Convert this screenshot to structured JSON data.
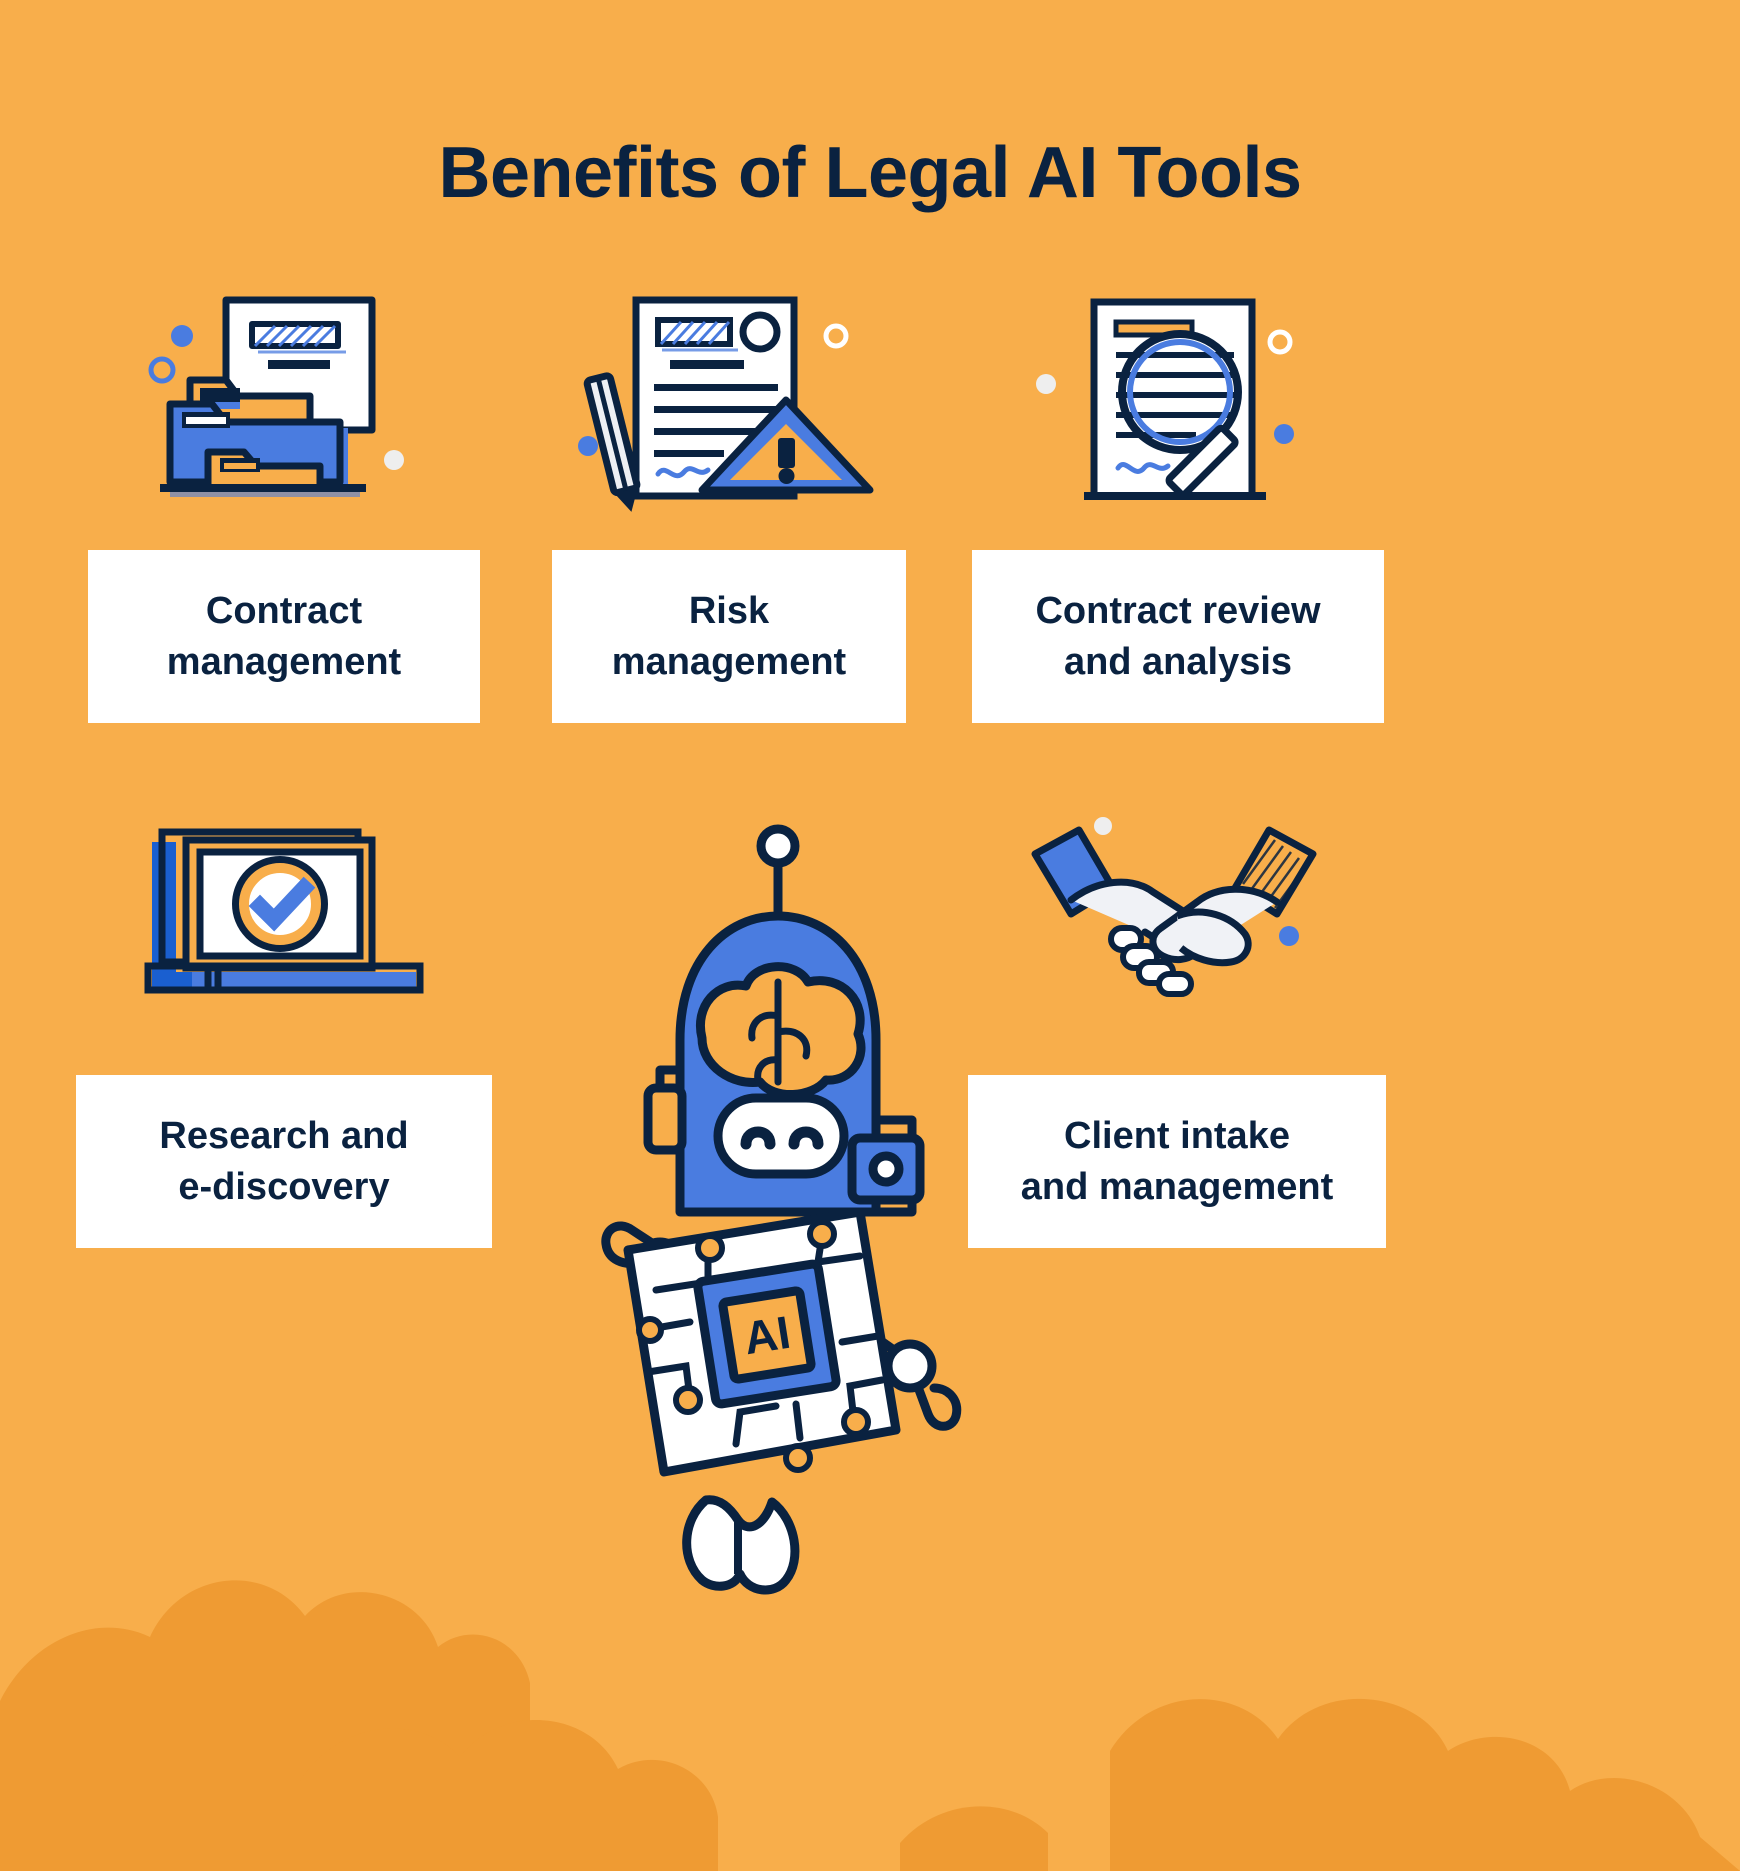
{
  "page": {
    "title": "Benefits of Legal AI Tools",
    "background_color": "#f8ae4b",
    "text_color": "#0a2240",
    "accent_blue": "#4a7ce0",
    "accent_blue_dark": "#1a5fd0",
    "card_background": "#ffffff",
    "cloud_color": "#ef9b33"
  },
  "benefits": [
    {
      "id": "contract-management",
      "label": "Contract\nmanagement",
      "line1": "Contract",
      "line2": "management",
      "icon": "folder-document-icon"
    },
    {
      "id": "risk-management",
      "label": "Risk\nmanagement",
      "line1": "Risk",
      "line2": "management",
      "icon": "document-warning-icon"
    },
    {
      "id": "contract-review-and-analysis",
      "label": "Contract review\nand analysis",
      "line1": "Contract review",
      "line2": "and analysis",
      "icon": "document-magnifier-icon"
    },
    {
      "id": "research-and-e-discovery",
      "label": "Research and\ne-discovery",
      "line1": "Research and",
      "line2": "e-discovery",
      "icon": "laptop-checkmark-icon"
    },
    {
      "id": "client-intake-and-management",
      "label": "Client intake\nand management",
      "line1": "Client intake",
      "line2": "and management",
      "icon": "handshake-icon"
    }
  ],
  "robot": {
    "name": "ai-robot-mascot",
    "chip_label": "AI",
    "chip_outer_color": "#4a7ce0",
    "chip_inner_color": "#f8ae4b",
    "body_color": "#4a7ce0",
    "outline_color": "#0a2240"
  }
}
